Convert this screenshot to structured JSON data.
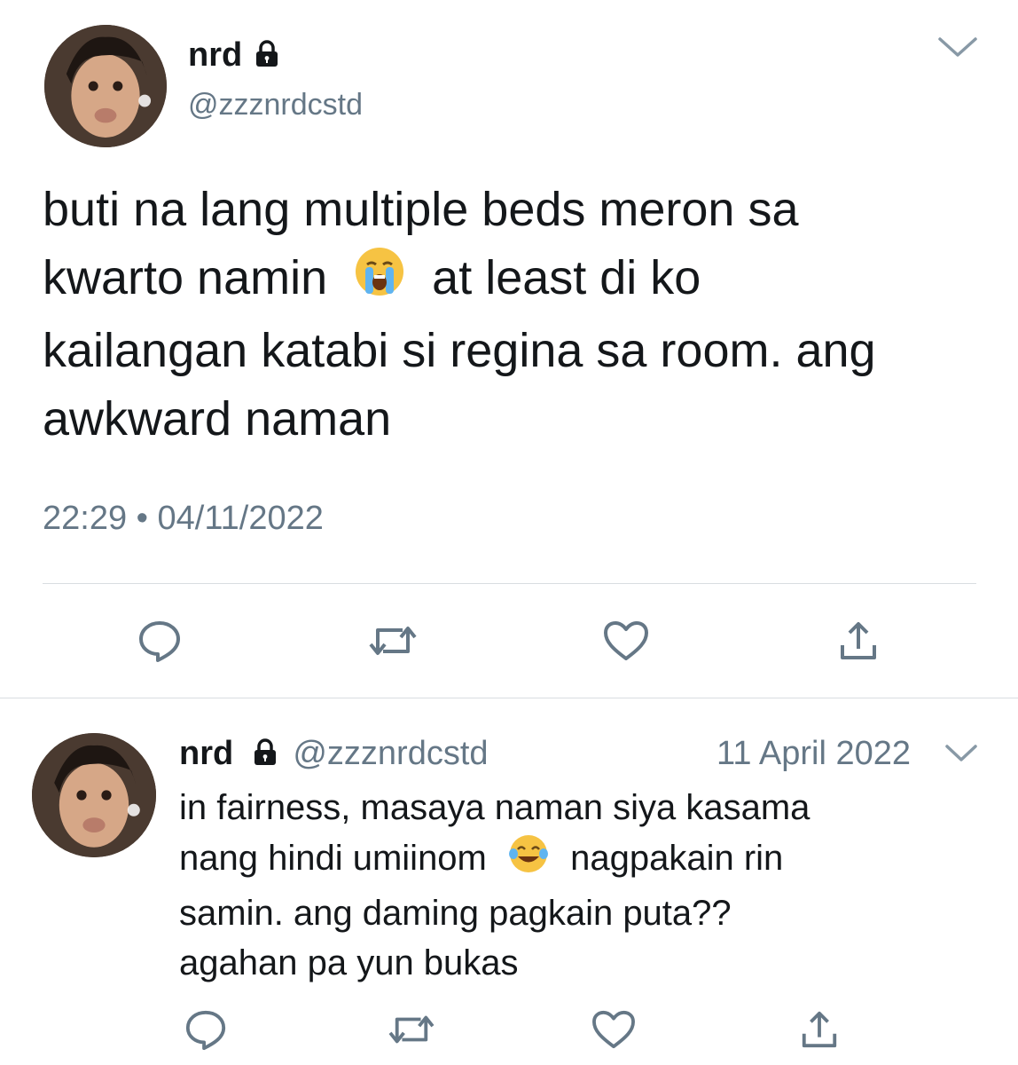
{
  "main_tweet": {
    "display_name": "nrd",
    "handle": "@zzznrdcstd",
    "text_line1": "buti na lang multiple beds meron sa",
    "text_line2a": "kwarto namin",
    "text_line2b": "at least di ko",
    "text_line3": "kailangan katabi si regina sa room. ang",
    "text_line4": "awkward naman",
    "emoji": "loudly-crying-face",
    "timestamp": "22:29 • 04/11/2022"
  },
  "reply_tweet": {
    "display_name": "nrd",
    "handle": "@zzznrdcstd",
    "date": "11 April 2022",
    "text_line1": "in fairness, masaya naman siya kasama",
    "text_line2a": "nang hindi umiinom",
    "text_line2b": "nagpakain rin",
    "text_line3": "samin. ang daming pagkain puta??",
    "text_line4": "agahan pa yun bukas",
    "emoji": "face-with-tears-of-joy"
  },
  "icons": [
    "lock-icon",
    "chevron-down-icon",
    "reply-icon",
    "retweet-icon",
    "like-icon",
    "share-icon"
  ],
  "colors": {
    "text": "#14171a",
    "muted": "#657786",
    "divider": "#d9dde1",
    "icon": "#657786"
  }
}
